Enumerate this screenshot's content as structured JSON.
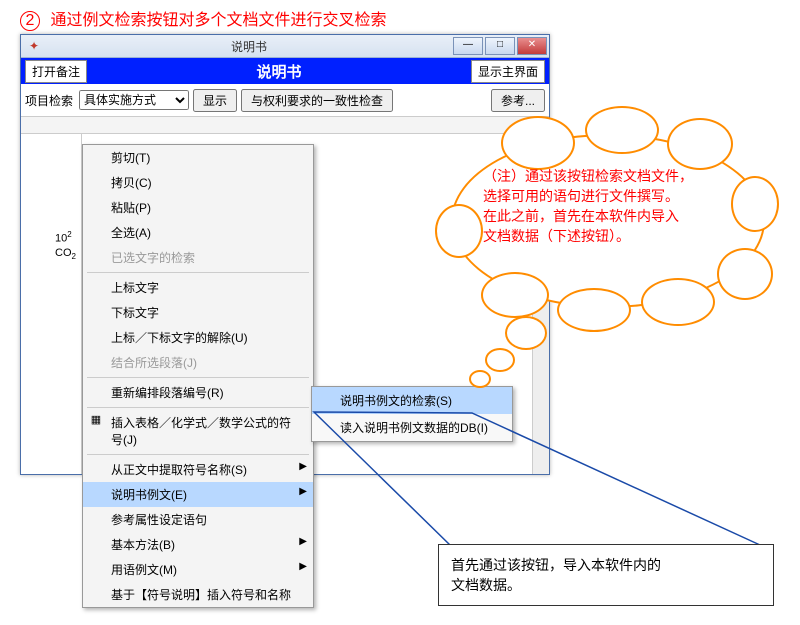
{
  "heading": {
    "number": "2",
    "text": "通过例文检索按钮对多个文档文件进行交叉检索"
  },
  "window": {
    "title": "说明书",
    "toolbar_blue": {
      "open_button": "打开备注",
      "title": "说明书",
      "right_button": "显示主界面"
    },
    "toolbar2": {
      "label": "项目检索",
      "select_value": "具体实施方式",
      "show_button": "显示",
      "consistency_button": "与权利要求的一致性检查",
      "ref_button": "参考..."
    },
    "gutter": {
      "sup_example": "10",
      "sup_exp": "2",
      "sub_example": "CO",
      "sub_num": "2"
    },
    "menu": [
      {
        "label": "剪切(T)",
        "type": "item"
      },
      {
        "label": "拷贝(C)",
        "type": "item"
      },
      {
        "label": "粘贴(P)",
        "type": "item"
      },
      {
        "label": "全选(A)",
        "type": "item"
      },
      {
        "label": "已选文字的检索",
        "type": "disabled"
      },
      {
        "type": "sep"
      },
      {
        "label": "上标文字",
        "type": "item"
      },
      {
        "label": "下标文字",
        "type": "item"
      },
      {
        "label": "上标／下标文字的解除(U)",
        "type": "item"
      },
      {
        "label": "结合所选段落(J)",
        "type": "disabled"
      },
      {
        "type": "sep"
      },
      {
        "label": "重新编排段落编号(R)",
        "type": "item"
      },
      {
        "type": "sep"
      },
      {
        "label": "插入表格／化学式／数学公式的符号(J)",
        "type": "item",
        "icon": "▦"
      },
      {
        "type": "sep"
      },
      {
        "label": "从正文中提取符号名称(S)",
        "type": "item",
        "arrow": true
      },
      {
        "label": "说明书例文(E)",
        "type": "highlighted",
        "arrow": true
      },
      {
        "label": "参考属性设定语句",
        "type": "item"
      },
      {
        "label": "基本方法(B)",
        "type": "item",
        "arrow": true
      },
      {
        "label": "用语例文(M)",
        "type": "item",
        "arrow": true
      },
      {
        "label": "基于【符号说明】插入符号和名称",
        "type": "item"
      }
    ],
    "submenu": [
      {
        "label": "说明书例文的检索(S)",
        "highlighted": true
      },
      {
        "label": "读入说明书例文数据的DB(I)",
        "highlighted": false
      }
    ]
  },
  "cloud": {
    "line1": "（注）通过该按钮检索文档文件，",
    "line2": "选择可用的语句进行文件撰写。",
    "line3": "在此之前，首先在本软件内导入",
    "line4": "文档数据（下述按钮）。"
  },
  "callout": {
    "line1": "首先通过该按钮，导入本软件内的",
    "line2": "文档数据。"
  }
}
